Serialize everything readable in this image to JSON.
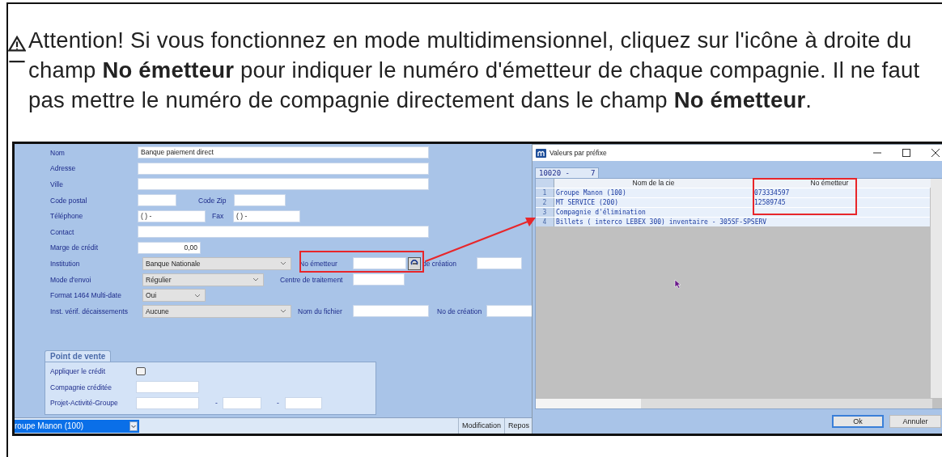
{
  "note": {
    "text": "Attention! Si vous fonctionnez en mode multidimensionnel, cliquez sur l'icône à droite du champ **No émetteur** pour indiquer le numéro d'émetteur de chaque compagnie. Il ne faut pas mettre le numéro de compagnie directement dans le champ **No émetteur**."
  },
  "form": {
    "rows": [
      {
        "items": [
          {
            "kind": "label",
            "text": "Nom"
          },
          {
            "kind": "input",
            "value": "Banque paiement direct"
          }
        ]
      },
      {
        "items": [
          {
            "kind": "label",
            "text": "Adresse"
          },
          {
            "kind": "input"
          }
        ]
      },
      {
        "items": [
          {
            "kind": "label",
            "text": "Ville"
          },
          {
            "kind": "input"
          }
        ]
      },
      {
        "items": [
          {
            "kind": "label",
            "text": "Code postal"
          },
          {
            "kind": "input"
          },
          {
            "kind": "label",
            "text": "Code Zip"
          },
          {
            "kind": "input"
          }
        ]
      },
      {
        "items": [
          {
            "kind": "label",
            "text": "Téléphone"
          },
          {
            "kind": "input",
            "value": "(  )  -"
          },
          {
            "kind": "label",
            "text": "Fax"
          },
          {
            "kind": "input",
            "value": "(  )  -"
          }
        ]
      },
      {
        "items": [
          {
            "kind": "label",
            "text": "Contact"
          },
          {
            "kind": "input"
          }
        ]
      },
      {
        "items": [
          {
            "kind": "label",
            "text": "Marge de crédit"
          },
          {
            "kind": "amount",
            "value": "0,00"
          }
        ]
      },
      {
        "items": [
          {
            "kind": "label",
            "text": "Institution"
          },
          {
            "kind": "select",
            "value": "Banque Nationale"
          },
          {
            "kind": "label",
            "text": "No émetteur"
          },
          {
            "kind": "input"
          },
          {
            "kind": "iconbutton"
          },
          {
            "kind": "label",
            "text": "de création"
          },
          {
            "kind": "input"
          }
        ]
      },
      {
        "items": [
          {
            "kind": "label",
            "text": "Mode d'envoi"
          },
          {
            "kind": "select",
            "value": "Régulier"
          },
          {
            "kind": "label",
            "text": "Centre de traitement"
          },
          {
            "kind": "input"
          }
        ]
      },
      {
        "items": [
          {
            "kind": "label",
            "text": "Format 1464 Multi-date"
          },
          {
            "kind": "select",
            "value": "Oui"
          }
        ]
      },
      {
        "items": [
          {
            "kind": "label",
            "text": "Inst. vérif. décaissements"
          },
          {
            "kind": "select",
            "value": "Aucune"
          },
          {
            "kind": "label",
            "text": "Nom du fichier"
          },
          {
            "kind": "input"
          },
          {
            "kind": "label",
            "text": "No de création"
          },
          {
            "kind": "input"
          }
        ]
      }
    ]
  },
  "pos_panel": {
    "tab": "Point de vente",
    "rows": [
      {
        "items": [
          {
            "kind": "label",
            "text": "Appliquer le crédit"
          },
          {
            "kind": "checkbox",
            "checked": false
          }
        ]
      },
      {
        "items": [
          {
            "kind": "label",
            "text": "Compagnie créditée"
          },
          {
            "kind": "input"
          }
        ]
      },
      {
        "items": [
          {
            "kind": "label",
            "text": "Projet-Activité-Groupe"
          },
          {
            "kind": "input"
          },
          {
            "kind": "label",
            "text": "-"
          },
          {
            "kind": "input"
          },
          {
            "kind": "label",
            "text": "-"
          },
          {
            "kind": "input"
          }
        ]
      }
    ]
  },
  "status_bar": {
    "company": "roupe Manon (100)",
    "sections": [
      "Modification",
      "Repos"
    ]
  },
  "dialog": {
    "title": "Valeurs par préfixe",
    "tabs": [
      {
        "label": "10020 -",
        "count": "7",
        "selected": true
      }
    ],
    "columns": [
      "Nom de la cie",
      "No émetteur"
    ],
    "rows": [
      {
        "num": "1",
        "name": "Groupe Manon (100)",
        "emitter": "073334597"
      },
      {
        "num": "2",
        "name": "MT SERVICE (200)",
        "emitter": "12589745"
      },
      {
        "num": "3",
        "name": "Compagnie d'élimination"
      },
      {
        "num": "4",
        "name": "Billets ( interco LEBEX 300) inventaire - 305SF-SPSERV"
      }
    ],
    "buttons": [
      {
        "label": "Ok",
        "focused": true
      },
      {
        "label": "Annuler",
        "focused": false
      }
    ]
  }
}
